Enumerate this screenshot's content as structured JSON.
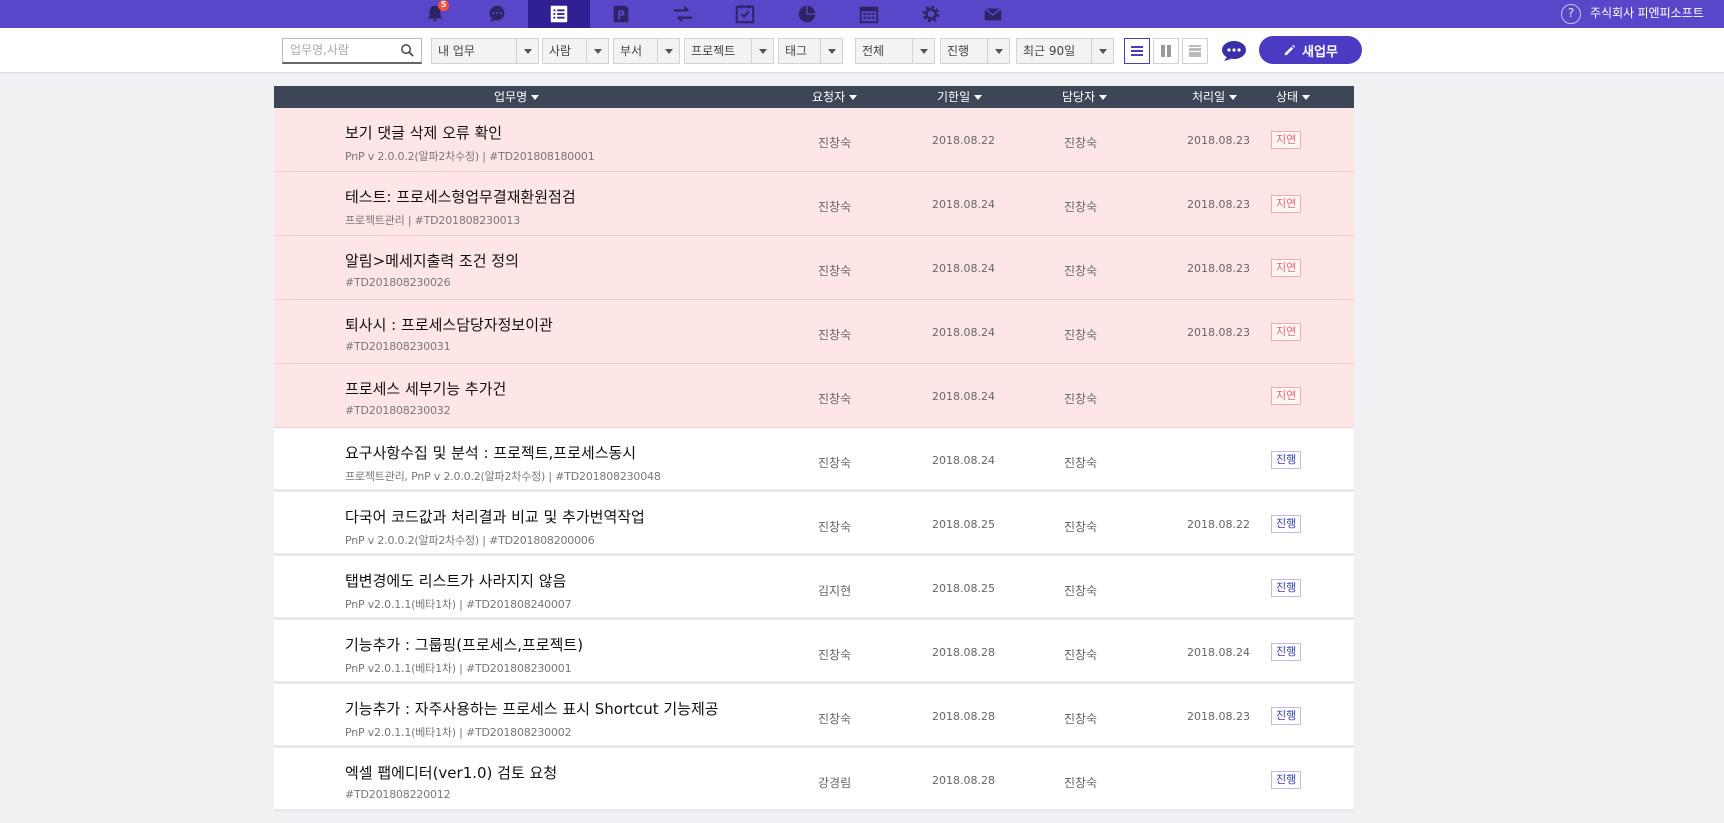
{
  "topbar": {
    "nav": [
      {
        "name": "notification-bell-icon",
        "badge": "5",
        "active": false
      },
      {
        "name": "chat-bubble-icon",
        "active": false
      },
      {
        "name": "task-list-icon",
        "active": true
      },
      {
        "name": "project-p-icon",
        "active": false
      },
      {
        "name": "transfer-arrows-icon",
        "active": false
      },
      {
        "name": "checkbox-icon",
        "active": false
      },
      {
        "name": "pie-chart-icon",
        "active": false
      },
      {
        "name": "calendar-icon",
        "active": false
      },
      {
        "name": "settings-gear-icon",
        "active": false
      },
      {
        "name": "mail-icon",
        "active": false
      }
    ],
    "help": "?",
    "company": "주식회사 피엔피소프트"
  },
  "toolbar": {
    "search_placeholder": "업무명,사람",
    "filters": {
      "scope": "내 업무",
      "person": "사람",
      "dept": "부서",
      "project": "프로젝트",
      "tag": "태그",
      "all": "전체",
      "state": "진행",
      "period": "최근 90일"
    },
    "new_task": "새업무"
  },
  "colors": {
    "topbar": "#5847c9",
    "accent": "#4a3bc2",
    "late_row": "#ffe6e6",
    "header": "#3d4656"
  },
  "table": {
    "headers": {
      "name": "업무명",
      "requester": "요청자",
      "due": "기한일",
      "owner": "담당자",
      "done": "처리일",
      "status": "상태"
    },
    "rows": [
      {
        "title": "보기 댓글 삭제 오류 확인",
        "sub": "PnP v 2.0.0.2(알파2차수정) | #TD201808180001",
        "requester": "진창숙",
        "due": "2018.08.22",
        "owner": "진창숙",
        "done": "2018.08.23",
        "status": "지연",
        "kind": "late"
      },
      {
        "title": "테스트: 프로세스형업무결재환원점검",
        "sub": "프로젝트관리 | #TD201808230013",
        "requester": "진창숙",
        "due": "2018.08.24",
        "owner": "진창숙",
        "done": "2018.08.23",
        "status": "지연",
        "kind": "late"
      },
      {
        "title": "알림>메세지출력 조건 정의",
        "sub": "#TD201808230026",
        "requester": "진창숙",
        "due": "2018.08.24",
        "owner": "진창숙",
        "done": "2018.08.23",
        "status": "지연",
        "kind": "late"
      },
      {
        "title": "퇴사시 : 프로세스담당자정보이관",
        "sub": "#TD201808230031",
        "requester": "진창숙",
        "due": "2018.08.24",
        "owner": "진창숙",
        "done": "2018.08.23",
        "status": "지연",
        "kind": "late"
      },
      {
        "title": "프로세스 세부기능 추가건",
        "sub": "#TD201808230032",
        "requester": "진창숙",
        "due": "2018.08.24",
        "owner": "진창숙",
        "done": "",
        "status": "지연",
        "kind": "late"
      },
      {
        "title": "요구사항수집 및 분석 : 프로젝트,프로세스동시",
        "sub": "프로젝트관리, PnP v 2.0.0.2(알파2차수정) | #TD201808230048",
        "requester": "진창숙",
        "due": "2018.08.24",
        "owner": "진창숙",
        "done": "",
        "status": "진행",
        "kind": "prog"
      },
      {
        "title": "다국어 코드값과 처리결과 비교 및 추가번역작업",
        "sub": "PnP v 2.0.0.2(알파2차수정) | #TD201808200006",
        "requester": "진창숙",
        "due": "2018.08.25",
        "owner": "진창숙",
        "done": "2018.08.22",
        "status": "진행",
        "kind": "prog"
      },
      {
        "title": "탭변경에도 리스트가 사라지지 않음",
        "sub": "PnP v2.0.1.1(베타1차) | #TD201808240007",
        "requester": "김지현",
        "due": "2018.08.25",
        "owner": "진창숙",
        "done": "",
        "status": "진행",
        "kind": "prog"
      },
      {
        "title": "기능추가 : 그룹핑(프로세스,프로젝트)",
        "sub": "PnP v2.0.1.1(베타1차) | #TD201808230001",
        "requester": "진창숙",
        "due": "2018.08.28",
        "owner": "진창숙",
        "done": "2018.08.24",
        "status": "진행",
        "kind": "prog"
      },
      {
        "title": "기능추가 : 자주사용하는 프로세스 표시 Shortcut 기능제공",
        "sub": "PnP v2.0.1.1(베타1차) | #TD201808230002",
        "requester": "진창숙",
        "due": "2018.08.28",
        "owner": "진창숙",
        "done": "2018.08.23",
        "status": "진행",
        "kind": "prog"
      },
      {
        "title": "엑셀 팹에디터(ver1.0) 검토 요청",
        "sub": "#TD201808220012",
        "requester": "강경림",
        "due": "2018.08.28",
        "owner": "진창숙",
        "done": "",
        "status": "진행",
        "kind": "prog"
      }
    ]
  }
}
